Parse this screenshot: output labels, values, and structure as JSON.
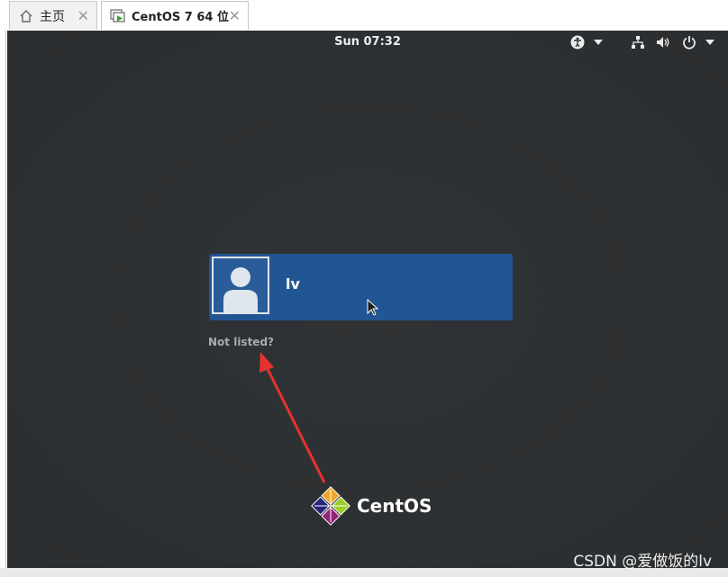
{
  "tabs": [
    {
      "label": "主页",
      "icon": "home-icon"
    },
    {
      "label": "CentOS 7 64 位",
      "icon": "vm-icon"
    }
  ],
  "topbar": {
    "clock": "Sun 07:32",
    "icons": [
      "accessibility-icon",
      "network-icon",
      "volume-icon",
      "power-icon"
    ]
  },
  "login": {
    "user": "lv",
    "not_listed": "Not listed?"
  },
  "branding": {
    "logo_text": "CentOS"
  },
  "watermark": "CSDN @爱做饭的lv",
  "colors": {
    "screen_bg": "#2e3133",
    "user_card": "#225594",
    "annotation_arrow": "#e8322f"
  }
}
